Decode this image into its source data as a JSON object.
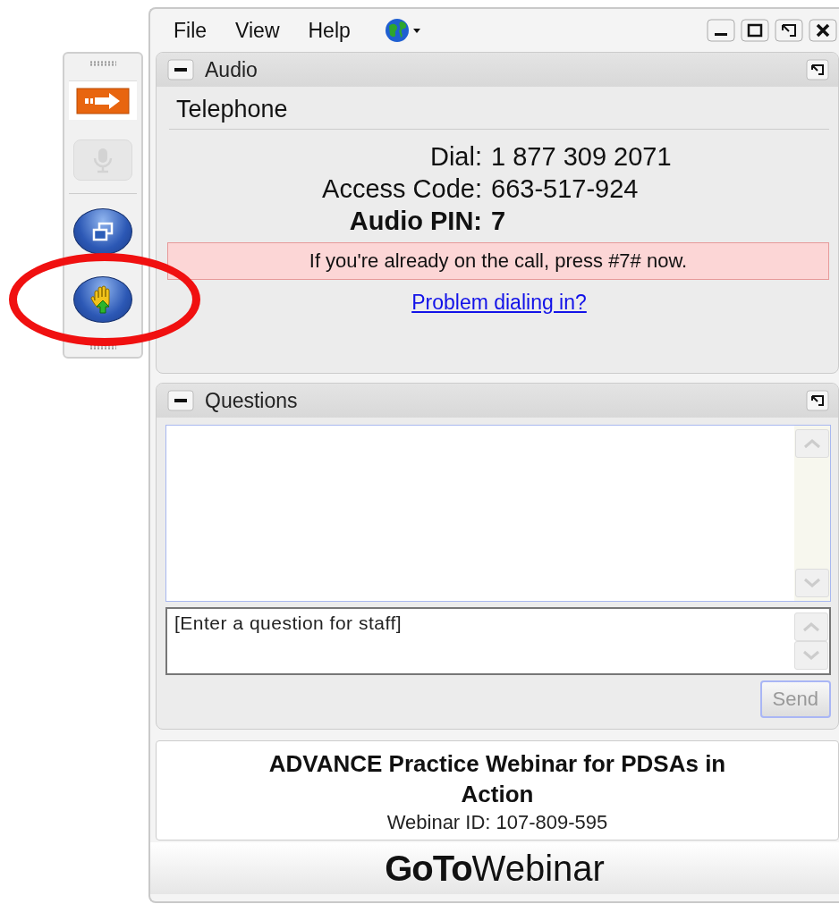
{
  "menu": [
    {
      "label": "File"
    },
    {
      "label": "View"
    },
    {
      "label": "Help"
    }
  ],
  "toolbar": {
    "buttons": [
      {
        "kind": "arrow",
        "disabled": false,
        "highlighted": false
      },
      {
        "kind": "mic",
        "disabled": true,
        "highlighted": false
      },
      {
        "kind": "screen",
        "disabled": false,
        "highlighted": false
      },
      {
        "kind": "hand",
        "disabled": false,
        "highlighted": true
      }
    ]
  },
  "audio": {
    "title": "Audio",
    "mode": "Telephone",
    "lines": [
      {
        "kind": "normal",
        "label": "Dial:",
        "value": "1 877 309 2071"
      },
      {
        "kind": "normal",
        "label": "Access Code:",
        "value": "663-517-924"
      },
      {
        "kind": "pin",
        "label": "Audio PIN:",
        "value": "7"
      }
    ],
    "alert": "If you're already on the call, press #7# now.",
    "link": "Problem dialing in?"
  },
  "questions": {
    "title": "Questions",
    "placeholder": "[Enter a question for staff]",
    "send": {
      "label": "Send",
      "disabled": true
    }
  },
  "webinar": {
    "title": "ADVANCE Practice Webinar for PDSAs in Action",
    "id": "Webinar ID: 107-809-595"
  },
  "brand": {
    "strong": "GoTo",
    "light": "Webinar"
  }
}
